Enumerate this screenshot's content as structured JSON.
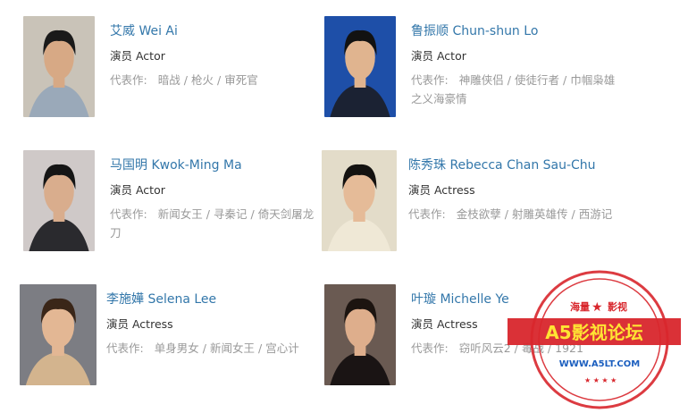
{
  "celebrities": [
    {
      "name": "艾威 Wei Ai",
      "role": "演员 Actor",
      "works_label": "代表作:",
      "works": [
        "暗战",
        "枪火",
        "审死官"
      ],
      "photo_bg": "#c9c3b8",
      "photo_skin": "#d7a985",
      "photo_cloth": "#9aa9b9",
      "photo_hair": "#1a1a1a"
    },
    {
      "name": "鲁振顺 Chun-shun Lo",
      "role": "演员 Actor",
      "works_label": "代表作:",
      "works": [
        "神雕侠侣",
        "使徒行者",
        "巾帼枭雄之义海豪情"
      ],
      "photo_bg": "#1e4fa8",
      "photo_skin": "#e0b48f",
      "photo_cloth": "#1b2233",
      "photo_hair": "#121212"
    },
    {
      "name": "马国明 Kwok-Ming Ma",
      "role": "演员 Actor",
      "works_label": "代表作:",
      "works": [
        "新闻女王",
        "寻秦记",
        "倚天剑屠龙刀"
      ],
      "photo_bg": "#cfc9c8",
      "photo_skin": "#d9ad8d",
      "photo_cloth": "#2a2a2e",
      "photo_hair": "#151515"
    },
    {
      "name": "陈秀珠 Rebecca Chan Sau-Chu",
      "role": "演员 Actress",
      "works_label": "代表作:",
      "works": [
        "金枝欲孽",
        "射雕英雄传",
        "西游记"
      ],
      "photo_bg": "#e3dcc9",
      "photo_skin": "#e5bb98",
      "photo_cloth": "#efe8d6",
      "photo_hair": "#141210"
    },
    {
      "name": "李施嬅 Selena Lee",
      "role": "演员 Actress",
      "works_label": "代表作:",
      "works": [
        "单身男女",
        "新闻女王",
        "宫心计"
      ],
      "photo_bg": "#7c7d83",
      "photo_skin": "#e3b794",
      "photo_cloth": "#d3b48e",
      "photo_hair": "#3a2618"
    },
    {
      "name": "叶璇 Michelle Ye",
      "role": "演员 Actress",
      "works_label": "代表作:",
      "works": [
        "窃听风云2",
        "毒战",
        "1921"
      ],
      "photo_bg": "#6a5a52",
      "photo_skin": "#deae8c",
      "photo_cloth": "#1a1414",
      "photo_hair": "#1c1410"
    }
  ],
  "watermark": {
    "top_left": "海量",
    "top_right": "影视",
    "title": "A5影视论坛",
    "url": "WWW.A5LT.COM",
    "color_red": "#d8262c",
    "color_yellow": "#ffe433",
    "color_blue": "#1c5fbf"
  }
}
